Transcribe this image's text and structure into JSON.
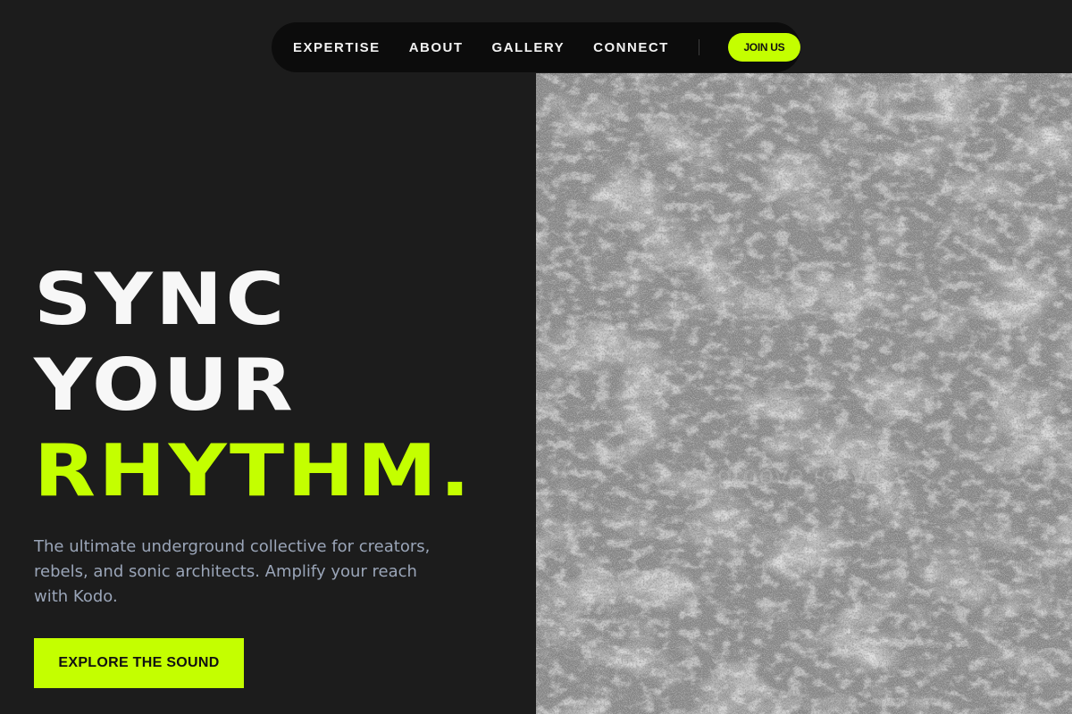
{
  "nav": {
    "links": [
      "EXPERTISE",
      "ABOUT",
      "GALLERY",
      "CONNECT"
    ],
    "join_label": "JOIN US"
  },
  "hero": {
    "line1": "SYNC",
    "line2": "YOUR",
    "line3": "RHYTHM.",
    "description": "The ultimate underground collective for creators, rebels, and sonic architects. Amplify your reach with Kodo.",
    "cta_label": "EXPLORE THE SOUND",
    "image_watermark": "groove tokyo"
  },
  "colors": {
    "background": "#1c1c1c",
    "accent": "#c4ff00",
    "navbar": "#0c0c0c",
    "text_primary": "#f7f7f7",
    "text_secondary": "#9aa5b8",
    "image_base": "#8a8a8a"
  }
}
